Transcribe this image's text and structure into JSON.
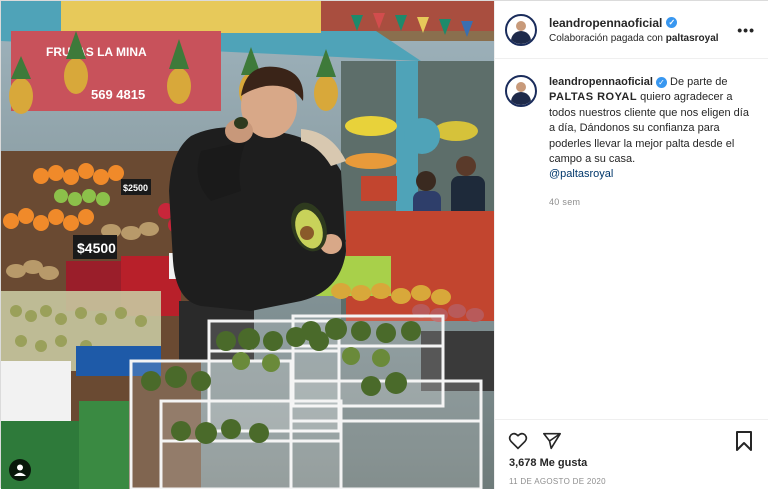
{
  "post": {
    "username": "leandropennaoficial",
    "sponsor_prefix": "Colaboración pagada con",
    "sponsor": "paltasroyal",
    "more_label": "•••"
  },
  "caption": {
    "text_prefix": "De parte de",
    "brand": "PALTAS ROYAL",
    "body": "quiero agradecer a todos nuestros cliente que nos eligen día a día, Dándonos su confianza para poderles llevar la mejor palta desde el campo a su casa.",
    "mention": "@paltasroyal",
    "age": "40 sem"
  },
  "photo": {
    "sign_price": "$4500",
    "sign_price2": "$2500",
    "banner_text": "FRUTAS LA MINA",
    "banner_phone": "569 4815"
  },
  "engagement": {
    "likes": "3,678 Me gusta",
    "date": "11 DE AGOSTO DE 2020"
  },
  "icons": [
    "heart-icon",
    "share-icon",
    "bookmark-icon",
    "user-tag-icon",
    "more-options-icon",
    "verified-icon"
  ],
  "colors": {
    "link": "#00376b",
    "verified": "#3897f0",
    "muted": "#8e8e8e"
  }
}
